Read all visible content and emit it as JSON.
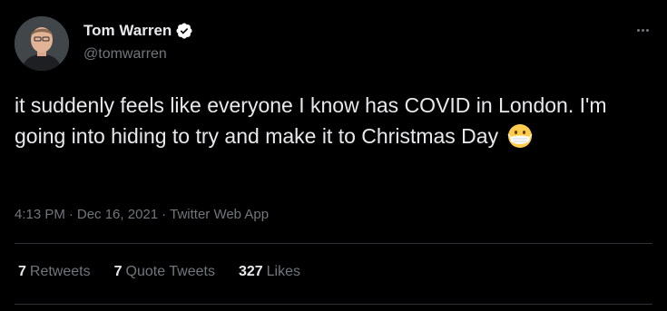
{
  "user": {
    "display_name": "Tom Warren",
    "handle": "@tomwarren",
    "verified": true
  },
  "tweet": {
    "text": "it suddenly feels like everyone I know has COVID in London. I'm going into hiding to try and make it to Christmas Day",
    "emoji": "😷",
    "time": "4:13 PM",
    "date": "Dec 16, 2021",
    "source": "Twitter Web App",
    "separator": "·"
  },
  "stats": {
    "retweets_count": "7",
    "retweets_label": "Retweets",
    "quote_count": "7",
    "quote_label": "Quote Tweets",
    "likes_count": "327",
    "likes_label": "Likes"
  },
  "colors": {
    "background": "#000000",
    "primary_text": "#e7e9ea",
    "secondary_text": "#71767b",
    "divider": "#2f3336",
    "verified_badge": "#ffffff"
  }
}
